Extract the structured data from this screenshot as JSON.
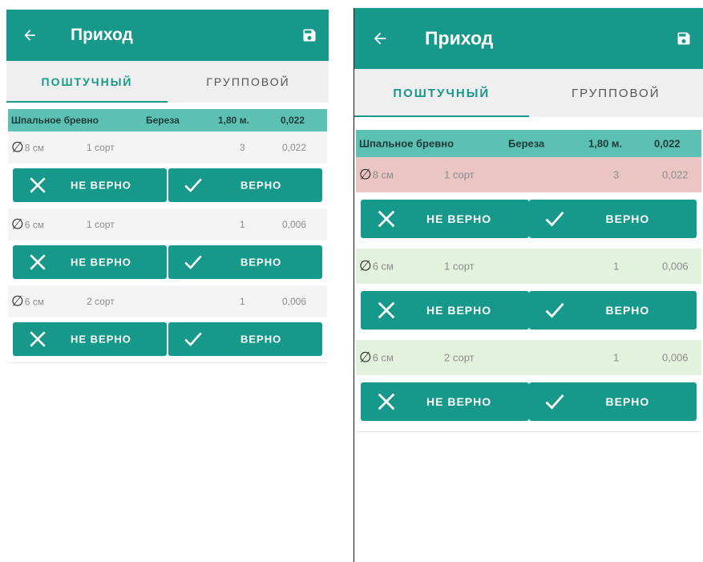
{
  "colors": {
    "primary": "#16998a",
    "header_row": "#5cc0b5",
    "wrong_bg": "#eac5c4",
    "correct_bg": "#e3f2dc"
  },
  "icons": {
    "back": "arrow-left-icon",
    "save": "save-icon",
    "wrong": "close-icon",
    "correct": "check-icon"
  },
  "screens": [
    {
      "app_title": "Приход",
      "tabs": [
        "ПОШТУЧНЫЙ",
        "ГРУППОВОЙ"
      ],
      "active_tab": 0,
      "summary": {
        "product": "Шпальное бревно",
        "species": "Береза",
        "length": "1,80 м.",
        "volume": "0,022"
      },
      "items": [
        {
          "diameter": "8 см",
          "grade": "1 сорт",
          "qty": "3",
          "volume": "0,022",
          "status": "none"
        },
        {
          "diameter": "6 см",
          "grade": "1 сорт",
          "qty": "1",
          "volume": "0,006",
          "status": "none"
        },
        {
          "diameter": "6 см",
          "grade": "2 сорт",
          "qty": "1",
          "volume": "0,006",
          "status": "none"
        }
      ],
      "btn_wrong": "НЕ ВЕРНО",
      "btn_correct": "ВЕРНО"
    },
    {
      "app_title": "Приход",
      "tabs": [
        "ПОШТУЧНЫЙ",
        "ГРУППОВОЙ"
      ],
      "active_tab": 0,
      "summary": {
        "product": "Шпальное бревно",
        "species": "Береза",
        "length": "1,80 м.",
        "volume": "0,022"
      },
      "items": [
        {
          "diameter": "8 см",
          "grade": "1 сорт",
          "qty": "3",
          "volume": "0,022",
          "status": "wrong"
        },
        {
          "diameter": "6 см",
          "grade": "1 сорт",
          "qty": "1",
          "volume": "0,006",
          "status": "correct"
        },
        {
          "diameter": "6 см",
          "grade": "2 сорт",
          "qty": "1",
          "volume": "0,006",
          "status": "correct"
        }
      ],
      "btn_wrong": "НЕ ВЕРНО",
      "btn_correct": "ВЕРНО"
    }
  ]
}
